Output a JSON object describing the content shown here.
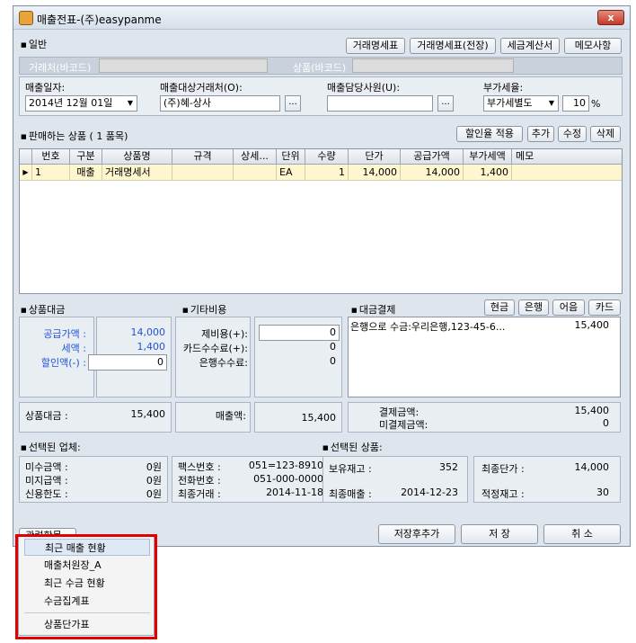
{
  "window": {
    "title": "매출전표-(주)easypanme",
    "close_label": "x"
  },
  "general": {
    "section_title": "일반",
    "buttons": [
      "거래명세표",
      "거래명세표(전장)",
      "세금계산서",
      "메모사항"
    ],
    "barcode_client_label": "거래처(바코드)",
    "barcode_product_label": "상품(바코드)",
    "date_label": "매출일자:",
    "date_value": "2014년 12월 01일",
    "client_label": "매출대상거래처(O):",
    "client_value": "(주)혜-상사",
    "staff_label": "매출담당사원(U):",
    "staff_value": "",
    "vat_label": "부가세율:",
    "vat_type": "부가세별도",
    "vat_rate": "10",
    "vat_unit": "%",
    "ellipsis": "..."
  },
  "products": {
    "section_title": "판매하는 상품 ( 1 품목)",
    "buttons": [
      "할인율 적용",
      "추가",
      "수정",
      "삭제"
    ],
    "columns": [
      "번호",
      "구분",
      "상품명",
      "규격",
      "상세...",
      "단위",
      "수량",
      "단가",
      "공급가액",
      "부가세액",
      "메모"
    ],
    "rows": [
      [
        "1",
        "매출",
        "거래명세서",
        "",
        "",
        "EA",
        "1",
        "14,000",
        "14,000",
        "1,400",
        ""
      ]
    ]
  },
  "goods_price": {
    "section_title": "상품대금",
    "supply_label": "공급가액 :",
    "supply_value": "14,000",
    "tax_label": "세액 :",
    "tax_value": "1,400",
    "discount_label": "할인액(-) :",
    "discount_value": "0",
    "total_label": "상품대금 :",
    "total_value": "15,400"
  },
  "other_costs": {
    "section_title": "기타비용",
    "misc_label": "제비용(+):",
    "misc_value": "0",
    "card_fee_label": "카드수수료(+):",
    "card_fee_value": "0",
    "bank_fee_label": "은행수수료:",
    "bank_fee_value": "0",
    "sales_label": "매출액:",
    "sales_value": "15,400"
  },
  "payment": {
    "section_title": "대금결제",
    "buttons": [
      "현금",
      "은행",
      "어음",
      "카드"
    ],
    "entry_text": "은행으로 수금:우리은행,123-45-6...",
    "entry_amount": "15,400",
    "paid_label": "결제금액:",
    "paid_value": "15,400",
    "unpaid_label": "미결제금액:",
    "unpaid_value": "0"
  },
  "selected_company": {
    "section_title": "선택된 업체:",
    "receivable_label": "미수금액 :",
    "receivable_value": "0원",
    "payable_label": "미지급액 :",
    "payable_value": "0원",
    "credit_label": "신용한도 :",
    "credit_value": "0원",
    "fax_label": "팩스번호 :",
    "fax_value": "051=123-8910",
    "phone_label": "전화번호 :",
    "phone_value": "051-000-0000",
    "last_trade_label": "최종거래 :",
    "last_trade_value": "2014-11-18"
  },
  "selected_product": {
    "section_title": "선택된 상품:",
    "stock_label": "보유재고 :",
    "stock_value": "352",
    "last_price_label": "최종단가 :",
    "last_price_value": "14,000",
    "last_sale_label": "최종매출 :",
    "last_sale_value": "2014-12-23",
    "proper_stock_label": "적정재고 :",
    "proper_stock_value": "30"
  },
  "footer": {
    "related_label": "관련항목",
    "save_add_label": "저장후추가",
    "save_label": "저 장",
    "cancel_label": "취 소"
  },
  "popup_menu": {
    "items": [
      "최근 매출 현황",
      "매출처원장_A",
      "최근 수금 현황",
      "수금집계표",
      "상품단가표"
    ]
  },
  "colors": {
    "highlight_border": "#e50000",
    "accent_text": "#1f53d8",
    "row_highlight": "#fdf6cf"
  }
}
